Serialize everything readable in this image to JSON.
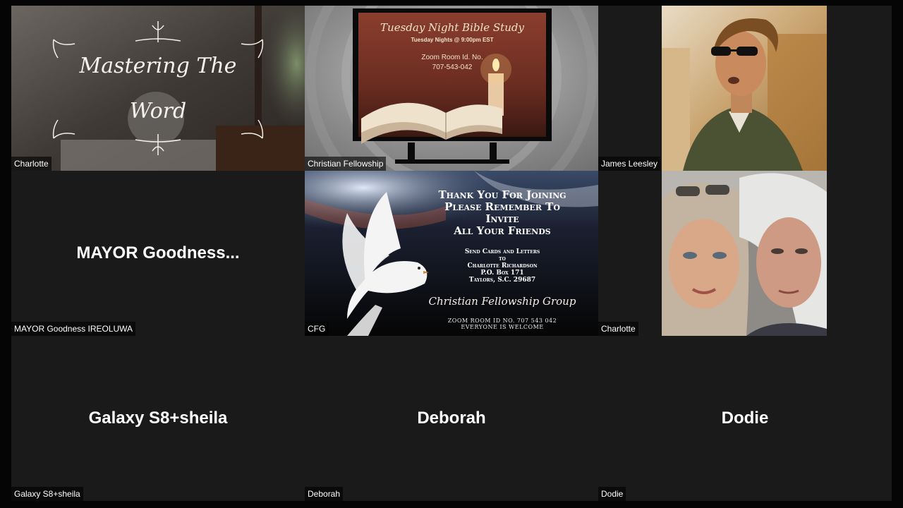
{
  "tiles": [
    {
      "name": "Charlotte",
      "kind": "video",
      "image": {
        "line1": "Mastering The",
        "line2": "Word"
      }
    },
    {
      "name": "Christian Fellowship",
      "kind": "video",
      "image": {
        "title": "Tuesday Night Bible Study",
        "subtitle": "Tuesday Nights @ 9:00pm EST",
        "room_label": "Zoom Room Id. No.",
        "room_number": "707-543-042"
      }
    },
    {
      "name": "James Leesley",
      "kind": "video"
    },
    {
      "name": "MAYOR Goodness IREOLUWA",
      "kind": "no-video",
      "display_name": "MAYOR  Goodness..."
    },
    {
      "name": "CFG",
      "kind": "video",
      "image": {
        "heading_lines": [
          "Thank You For Joining",
          "Please Remember To",
          "Invite",
          "All Your Friends"
        ],
        "send_lines": [
          "Send Cards and Letters",
          "to",
          "Charlotte Richardson",
          "P.O. Box 171",
          "Taylors, S.C. 29687"
        ],
        "group_name": "Christian Fellowship Group",
        "footer_lines": [
          "Zoom Room ID No. 707 543 042",
          "Everyone is Welcome"
        ]
      }
    },
    {
      "name": "Charlotte",
      "kind": "video"
    },
    {
      "name": "Galaxy S8+sheila",
      "kind": "no-video",
      "display_name": "Galaxy S8+sheila"
    },
    {
      "name": "Deborah",
      "kind": "no-video",
      "display_name": "Deborah"
    },
    {
      "name": "Dodie",
      "kind": "no-video",
      "display_name": "Dodie"
    }
  ],
  "colors": {
    "tile_background": "#1a1a1a",
    "label_text": "#ffffff"
  }
}
